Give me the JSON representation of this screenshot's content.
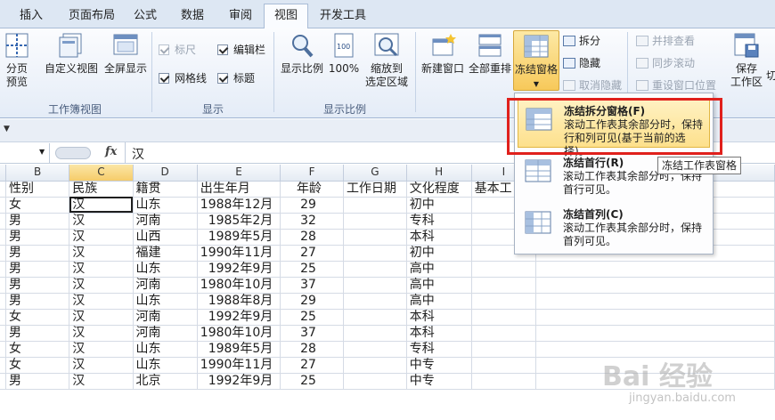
{
  "tabs": [
    "插入",
    "页面布局",
    "公式",
    "数据",
    "审阅",
    "视图",
    "开发工具"
  ],
  "ribbon": {
    "views": {
      "page_preview_1": "分页",
      "page_preview_2": "预览",
      "custom_view": "自定义视图",
      "fullscreen": "全屏显示",
      "group_label": "工作簿视图"
    },
    "show": {
      "ruler": "标尺",
      "gridlines": "网格线",
      "formula_bar": "编辑栏",
      "headings": "标题",
      "group_label": "显示"
    },
    "zoom": {
      "zoom": "显示比例",
      "hundred": "100%",
      "zoom_sel_1": "缩放到",
      "zoom_sel_2": "选定区域",
      "group_label": "显示比例"
    },
    "window": {
      "new_window": "新建窗口",
      "arrange_all": "全部重排",
      "freeze_panes": "冻结窗格",
      "split": "拆分",
      "hide": "隐藏",
      "unhide": "取消隐藏",
      "side_by_side": "并排查看",
      "sync_scroll": "同步滚动",
      "reset_pos": "重设窗口位置",
      "save_workspace_1": "保存",
      "save_workspace_2": "工作区",
      "switch": "切"
    }
  },
  "formula": {
    "fx": "fx",
    "value": "汉"
  },
  "columns": [
    "B",
    "C",
    "D",
    "E",
    "F",
    "G",
    "H",
    "I"
  ],
  "headers": [
    "性别",
    "民族",
    "籍贯",
    "出生年月",
    "年龄",
    "工作日期",
    "文化程度",
    "基本工"
  ],
  "rows": [
    [
      "女",
      "汉",
      "山东",
      "1988年12月",
      "29",
      "",
      "初中"
    ],
    [
      "男",
      "汉",
      "河南",
      "1985年2月",
      "32",
      "",
      "专科"
    ],
    [
      "男",
      "汉",
      "山西",
      "1989年5月",
      "28",
      "",
      "本科"
    ],
    [
      "男",
      "汉",
      "福建",
      "1990年11月",
      "27",
      "",
      "初中"
    ],
    [
      "男",
      "汉",
      "山东",
      "1992年9月",
      "25",
      "",
      "高中"
    ],
    [
      "男",
      "汉",
      "河南",
      "1980年10月",
      "37",
      "",
      "高中"
    ],
    [
      "男",
      "汉",
      "山东",
      "1988年8月",
      "29",
      "",
      "高中"
    ],
    [
      "女",
      "汉",
      "河南",
      "1992年9月",
      "25",
      "",
      "本科"
    ],
    [
      "男",
      "汉",
      "河南",
      "1980年10月",
      "37",
      "",
      "本科"
    ],
    [
      "女",
      "汉",
      "山东",
      "1989年5月",
      "28",
      "",
      "专科"
    ],
    [
      "女",
      "汉",
      "山东",
      "1990年11月",
      "27",
      "",
      "中专"
    ],
    [
      "男",
      "汉",
      "北京",
      "1992年9月",
      "25",
      "",
      "中专"
    ]
  ],
  "menu": [
    {
      "title": "冻结拆分窗格(F)",
      "desc": "滚动工作表其余部分时，保持行和列可见(基于当前的选择)。"
    },
    {
      "title": "冻结首行(R)",
      "desc": "滚动工作表其余部分时，保持首行可见。"
    },
    {
      "title": "冻结首列(C)",
      "desc": "滚动工作表其余部分时，保持首列可见。"
    }
  ],
  "tooltip": "冻结工作表窗格",
  "watermark": {
    "main": "Bai 经验",
    "sub": "jingyan.baidu.com"
  }
}
